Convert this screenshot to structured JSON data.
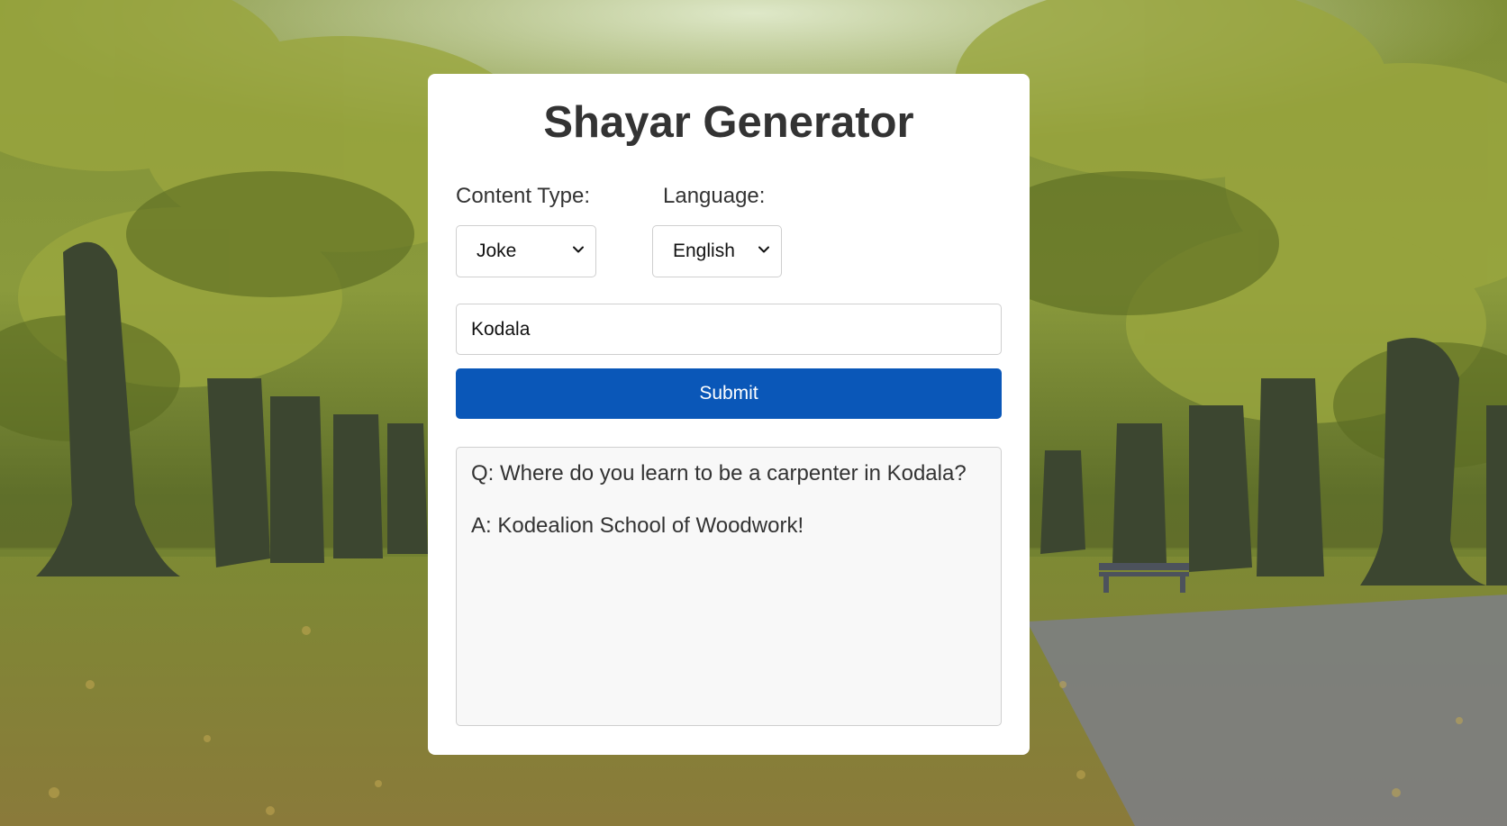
{
  "app": {
    "title": "Shayar Generator"
  },
  "form": {
    "content_type_label": "Content Type:",
    "content_type_value": "Joke",
    "language_label": "Language:",
    "language_value": "English",
    "topic_value": "Kodala",
    "submit_label": "Submit"
  },
  "output": {
    "lines": [
      "Q: Where do you learn to be a carpenter in Kodala?",
      "A: Kodealion School of Woodwork!"
    ]
  },
  "colors": {
    "accent": "#0a57b8",
    "card_bg": "#ffffff",
    "output_bg": "#f8f8f8",
    "text": "#333333"
  },
  "icons": {
    "select_arrow": "chevron-down-icon",
    "background": "park-trees-image"
  }
}
